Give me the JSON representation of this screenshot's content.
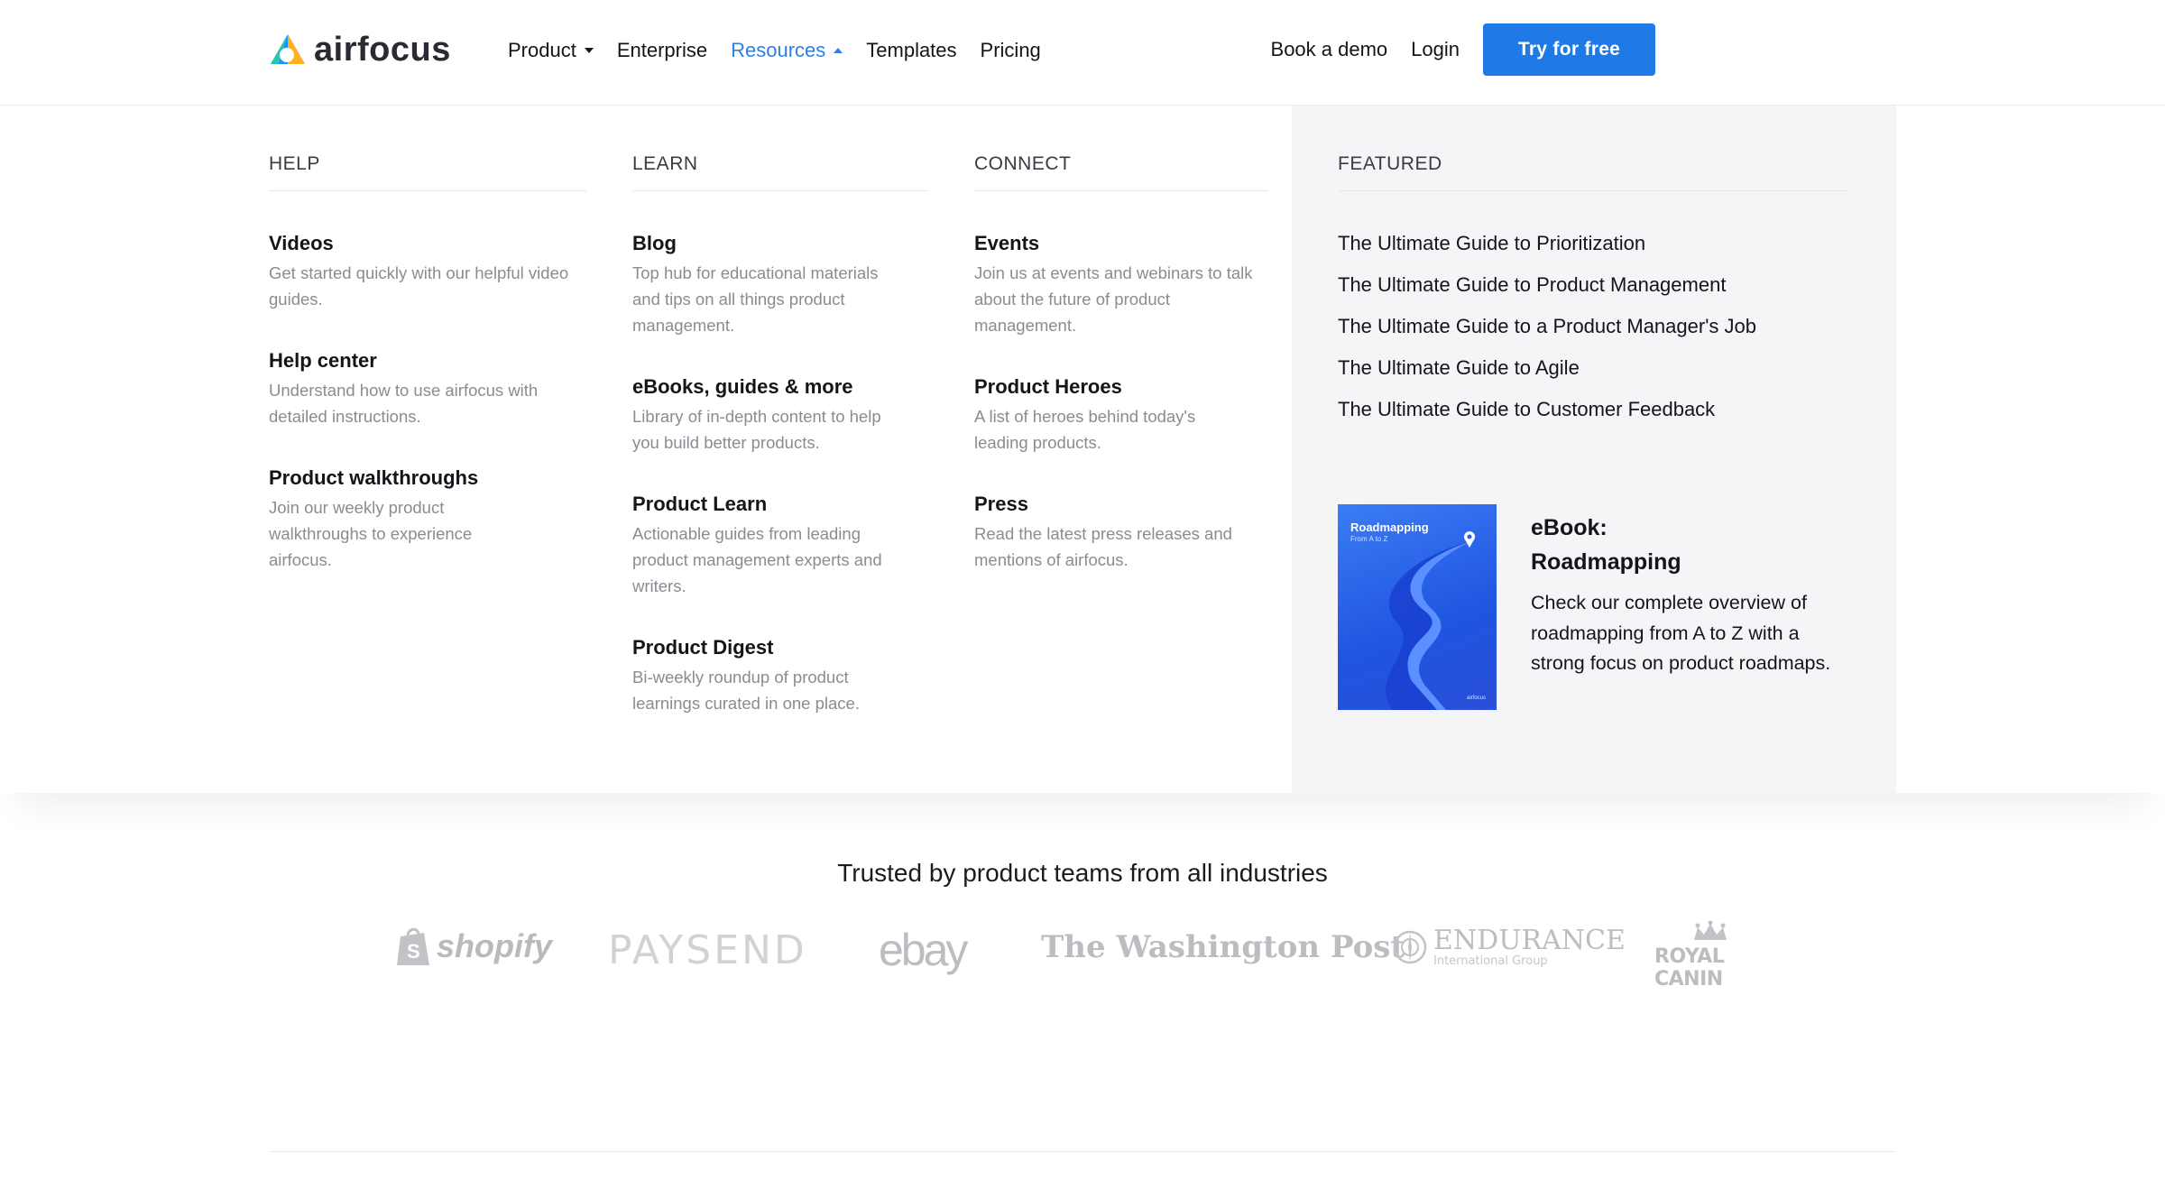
{
  "header": {
    "logo_text": "airfocus",
    "nav": [
      {
        "label": "Product",
        "has_dropdown": true,
        "active": false
      },
      {
        "label": "Enterprise",
        "has_dropdown": false,
        "active": false
      },
      {
        "label": "Resources",
        "has_dropdown": true,
        "active": true
      },
      {
        "label": "Templates",
        "has_dropdown": false,
        "active": false
      },
      {
        "label": "Pricing",
        "has_dropdown": false,
        "active": false
      }
    ],
    "book_demo": "Book a demo",
    "login": "Login",
    "cta": "Try for free"
  },
  "dropdown": {
    "help": {
      "title": "HELP",
      "items": [
        {
          "title": "Videos",
          "desc": "Get started quickly with our helpful video guides."
        },
        {
          "title": "Help center",
          "desc": "Understand how to use airfocus with detailed instructions."
        },
        {
          "title": "Product walkthroughs",
          "desc": "Join our weekly product walkthroughs to experience airfocus."
        }
      ]
    },
    "learn": {
      "title": "LEARN",
      "items": [
        {
          "title": "Blog",
          "desc": "Top hub for educational materials and tips on all things product management."
        },
        {
          "title": "eBooks, guides & more",
          "desc": "Library of in-depth content to help you build better products."
        },
        {
          "title": "Product Learn",
          "desc": "Actionable guides from leading product management experts and writers."
        },
        {
          "title": "Product Digest",
          "desc": "Bi-weekly roundup of product learnings curated in one place."
        }
      ]
    },
    "connect": {
      "title": "CONNECT",
      "items": [
        {
          "title": "Events",
          "desc": "Join us at events and webinars to talk about the future of product management."
        },
        {
          "title": "Product Heroes",
          "desc": "A list of heroes behind today's leading products."
        },
        {
          "title": "Press",
          "desc": "Read the latest press releases and mentions of airfocus."
        }
      ]
    },
    "featured": {
      "title": "FEATURED",
      "guides": [
        "The Ultimate Guide to Prioritization",
        "The Ultimate Guide to Product Management",
        "The Ultimate Guide to a Product Manager's Job",
        "The Ultimate Guide to Agile",
        "The Ultimate Guide to Customer Feedback"
      ],
      "ebook": {
        "cover_title": "Roadmapping",
        "cover_subtitle": "From A to Z",
        "cover_brand": "airfocus",
        "title_line1": "eBook:",
        "title_line2": "Roadmapping",
        "desc": "Check our complete overview of roadmapping from A to Z with a strong focus on product roadmaps."
      }
    }
  },
  "trusted": {
    "heading": "Trusted by product teams from all industries",
    "logos": [
      "shopify",
      "PAYSEND",
      "ebay",
      "The Washington Post",
      "ENDURANCE",
      "International Group",
      "ROYAL CANIN"
    ]
  },
  "colors": {
    "accent": "#1f79e7",
    "active_nav": "#2f7ee5",
    "muted_text": "#8b8b93",
    "featured_bg": "#f5f5f7",
    "logo_gray": "#b9b9be"
  }
}
